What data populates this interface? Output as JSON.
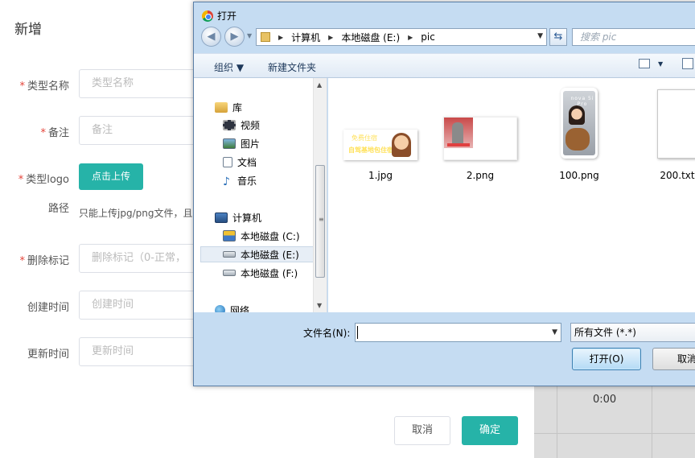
{
  "form": {
    "title": "新增",
    "required_mark": "*",
    "fields": [
      {
        "label": "类型名称",
        "placeholder": "类型名称",
        "required": true
      },
      {
        "label": "备注",
        "placeholder": "备注",
        "required": true
      },
      {
        "label": "类型logo",
        "required": true
      },
      {
        "label": "路径",
        "required": false
      },
      {
        "label": "删除标记",
        "placeholder": "删除标记（0-正常，",
        "required": true
      },
      {
        "label": "创建时间",
        "placeholder": "创建时间",
        "required": false
      },
      {
        "label": "更新时间",
        "placeholder": "更新时间",
        "required": false
      }
    ],
    "upload_button": "点击上传",
    "upload_hint": "只能上传jpg/png文件，且不",
    "cancel_button": "取消",
    "confirm_button": "确定",
    "background_time": "0:00"
  },
  "dialog": {
    "title": "打开",
    "nav_back_icon": "back-arrow-icon",
    "nav_forward_icon": "forward-arrow-icon",
    "breadcrumb": [
      "计算机",
      "本地磁盘 (E:)",
      "pic"
    ],
    "search_placeholder": "搜索 pic",
    "toolbar": {
      "organize": "组织",
      "new_folder": "新建文件夹"
    },
    "nav_items": {
      "library": "库",
      "video": "视频",
      "pictures": "图片",
      "documents": "文档",
      "music": "音乐",
      "computer": "计算机",
      "drive_c": "本地磁盘 (C:)",
      "drive_e": "本地磁盘 (E:)",
      "drive_f": "本地磁盘 (F:)",
      "network": "网络"
    },
    "files": [
      {
        "name": "1.jpg"
      },
      {
        "name": "2.png"
      },
      {
        "name": "100.png"
      },
      {
        "name": "200.txt"
      }
    ],
    "thumb_texts": {
      "banner_line1": "免费住宿",
      "banner_line2": "自驾基地包住宿",
      "phone_brand": "nova 5i Pro"
    },
    "filename_label": "文件名(N):",
    "filename_value": "",
    "filetype_value": "所有文件 (*.*)",
    "open_button": "打开(O)",
    "cancel_button": "取消"
  },
  "colors": {
    "accent": "#26b3a8",
    "required": "#e4443a",
    "dialog_frame": "#c5dcf2"
  }
}
